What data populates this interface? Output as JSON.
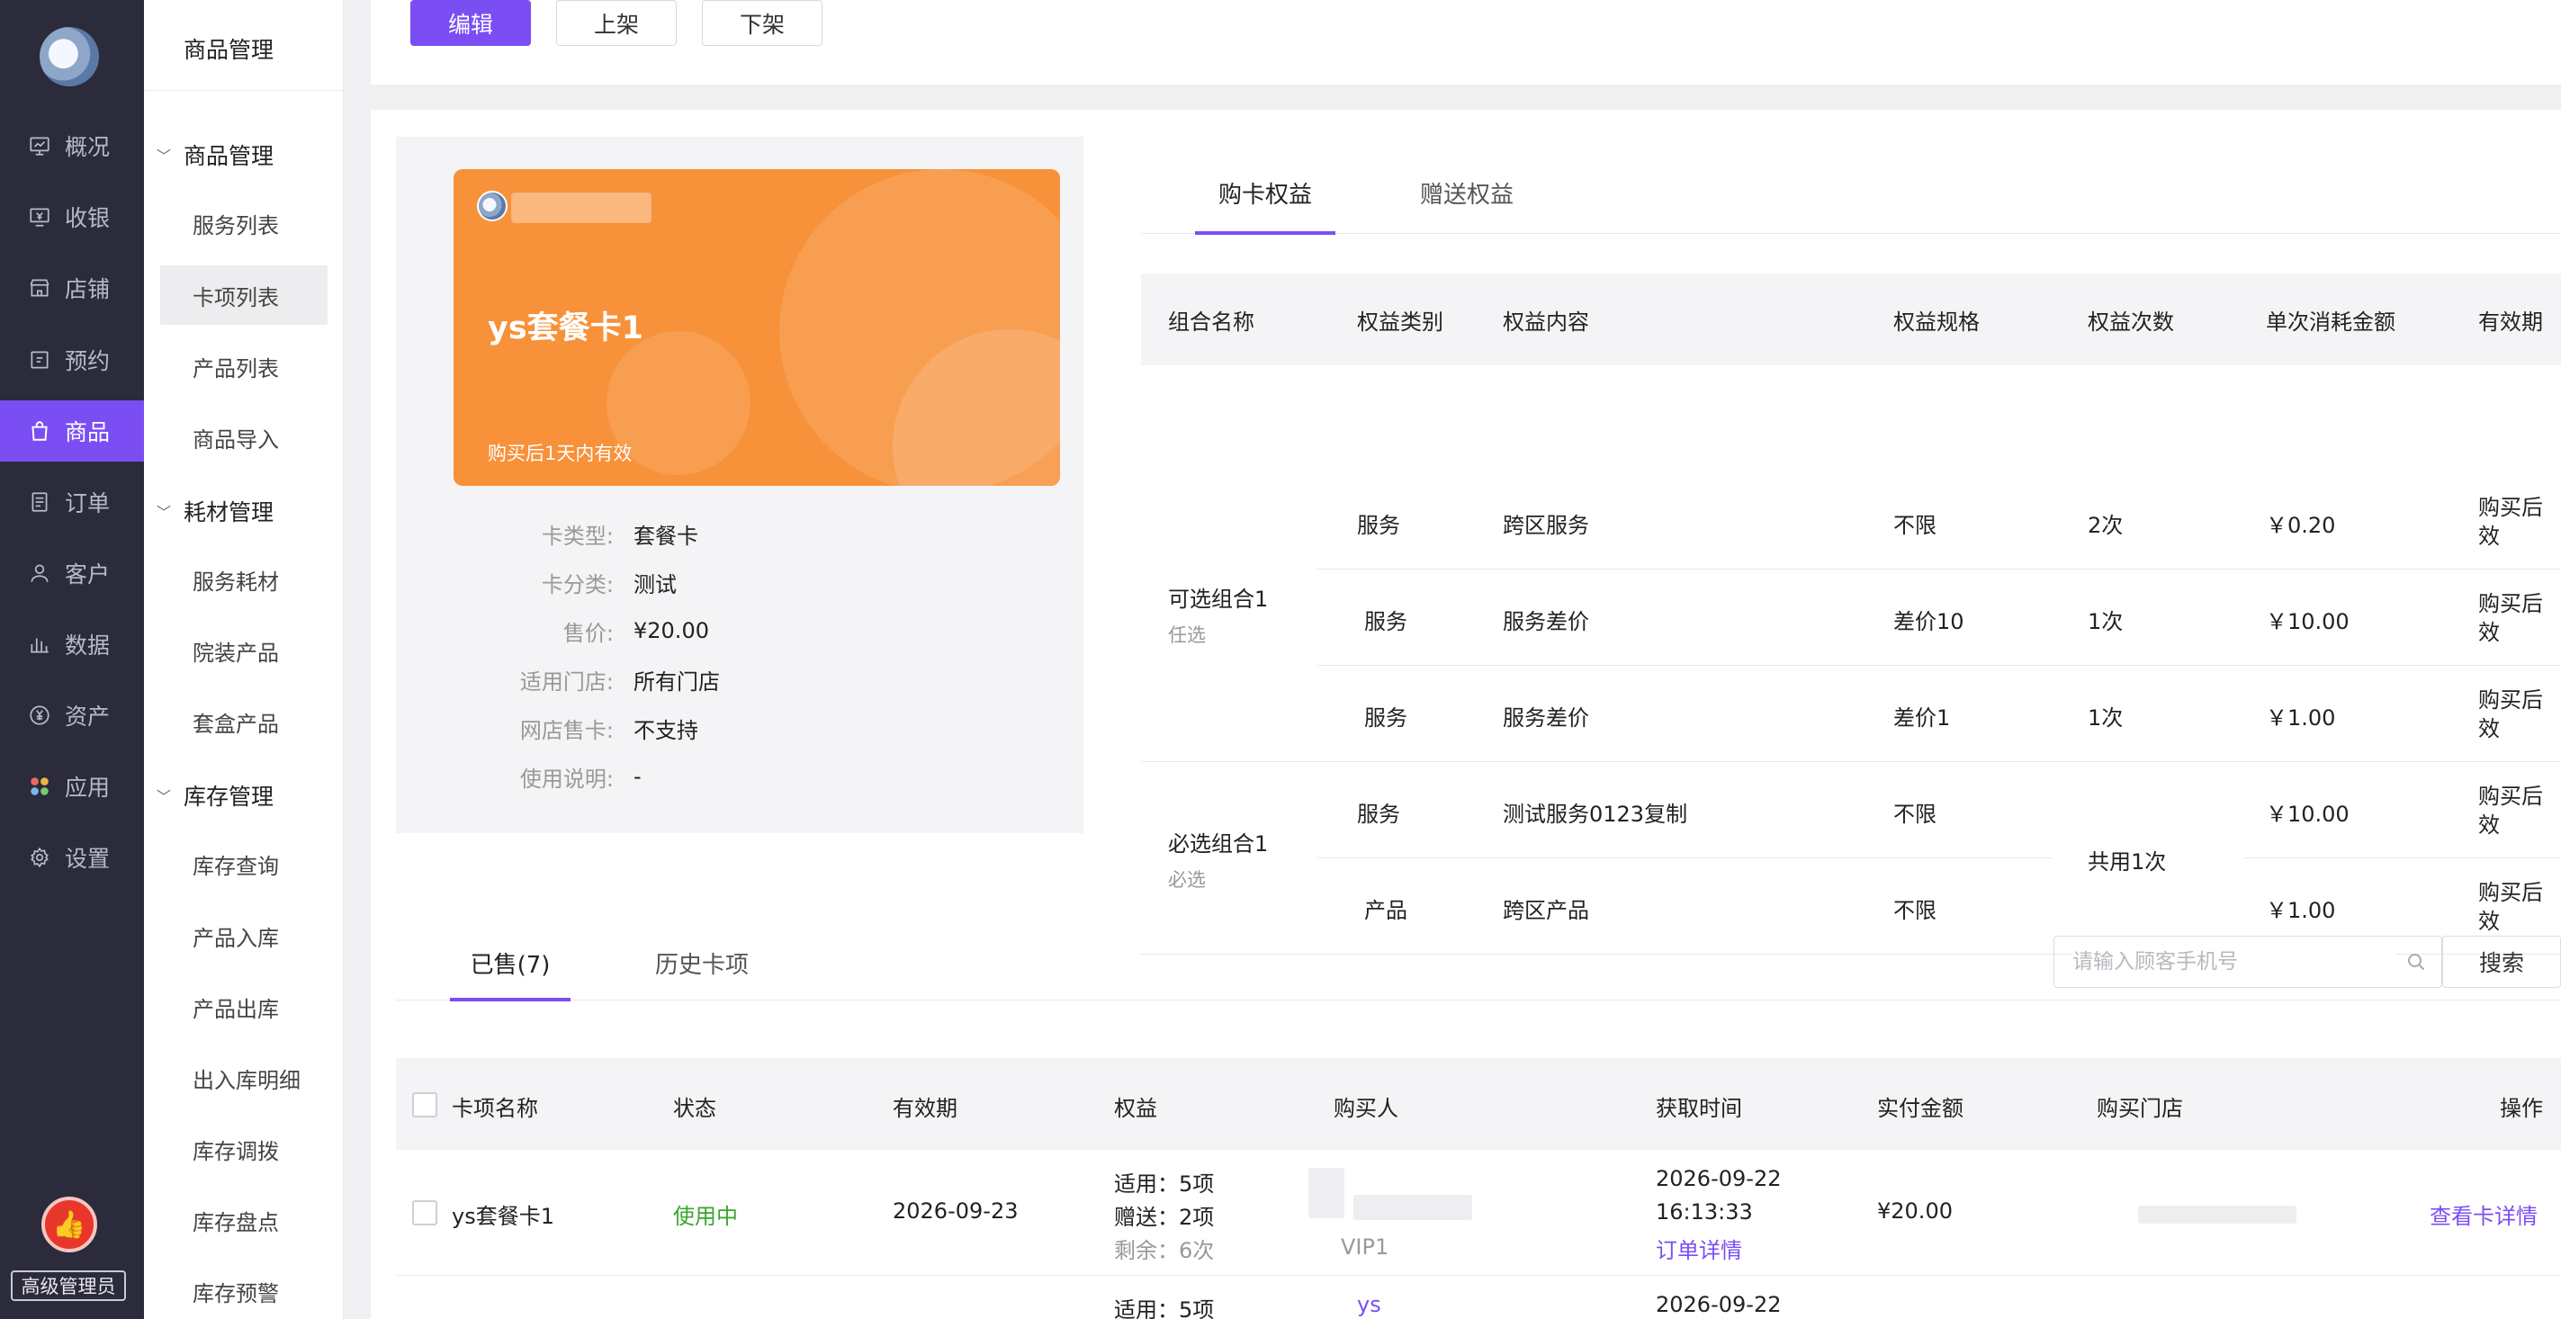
{
  "rail": {
    "items": [
      {
        "label": "概况",
        "icon": "monitor-icon"
      },
      {
        "label": "收银",
        "icon": "cashier-icon"
      },
      {
        "label": "店铺",
        "icon": "store-icon"
      },
      {
        "label": "预约",
        "icon": "calendar-icon"
      },
      {
        "label": "商品",
        "icon": "bag-icon",
        "active": true
      },
      {
        "label": "订单",
        "icon": "order-icon"
      },
      {
        "label": "客户",
        "icon": "user-icon"
      },
      {
        "label": "数据",
        "icon": "bar-chart-icon"
      },
      {
        "label": "资产",
        "icon": "yen-icon"
      },
      {
        "label": "应用",
        "icon": "apps-icon"
      },
      {
        "label": "设置",
        "icon": "gear-icon"
      }
    ],
    "role": "高级管理员",
    "accent": "#7a4ef3"
  },
  "submenu": {
    "title": "商品管理",
    "groups": [
      {
        "label": "商品管理",
        "items": [
          "服务列表",
          "卡项列表",
          "产品列表",
          "商品导入"
        ]
      },
      {
        "label": "耗材管理",
        "items": [
          "服务耗材",
          "院装产品",
          "套盒产品"
        ]
      },
      {
        "label": "库存管理",
        "items": [
          "库存查询",
          "产品入库",
          "产品出库",
          "出入库明细",
          "库存调拨",
          "库存盘点",
          "库存预警"
        ]
      }
    ],
    "active_item": "卡项列表"
  },
  "toolbar": {
    "edit": "编辑",
    "list_on": "上架",
    "list_off": "下架"
  },
  "card": {
    "name": "ys套餐卡1",
    "validity_note": "购买后1天内有效",
    "color": "#f7913a",
    "info": [
      {
        "k": "卡类型:",
        "v": "套餐卡"
      },
      {
        "k": "卡分类:",
        "v": "测试"
      },
      {
        "k": "售价:",
        "v": "¥20.00"
      },
      {
        "k": "适用门店:",
        "v": "所有门店"
      },
      {
        "k": "网店售卡:",
        "v": "不支持"
      },
      {
        "k": "使用说明:",
        "v": "-"
      }
    ]
  },
  "rights_tabs": [
    "购卡权益",
    "赠送权益"
  ],
  "rights_table": {
    "headers": [
      "组合名称",
      "权益类别",
      "权益内容",
      "权益规格",
      "权益次数",
      "单次消耗金额",
      "有效期"
    ],
    "groups": [
      {
        "name": "可选组合1",
        "sub": "任选"
      },
      {
        "name": "必选组合1",
        "sub": "必选"
      }
    ],
    "rows": [
      {
        "cat": "服务",
        "content": "跨区服务",
        "spec": "不限",
        "times": "2次",
        "amount": "￥0.20",
        "valid": "购买后\n效"
      },
      {
        "cat": "服务",
        "content": "服务差价",
        "spec": "差价10",
        "times": "1次",
        "amount": "￥10.00",
        "valid": "购买后\n效"
      },
      {
        "cat": "服务",
        "content": "服务差价",
        "spec": "差价1",
        "times": "1次",
        "amount": "￥1.00",
        "valid": "购买后\n效"
      },
      {
        "cat": "服务",
        "content": "测试服务0123复制",
        "spec": "不限",
        "times": "",
        "amount": "￥10.00",
        "valid": "购买后\n效"
      },
      {
        "cat": "产品",
        "content": "跨区产品",
        "spec": "不限",
        "times": "",
        "amount": "￥1.00",
        "valid": "购买后\n效"
      }
    ],
    "shared_times": "共用1次"
  },
  "sold_tabs": [
    "已售(7)",
    "历史卡项"
  ],
  "search": {
    "placeholder": "请输入顾客手机号",
    "button": "搜索"
  },
  "sold_table": {
    "headers": [
      "卡项名称",
      "状态",
      "有效期",
      "权益",
      "购买人",
      "获取时间",
      "实付金额",
      "购买门店",
      "操作"
    ],
    "rows": [
      {
        "name": "ys套餐卡1",
        "status": "使用中",
        "expire": "2026-09-23",
        "rights": [
          "适用：5项",
          "赠送：2项",
          "剩余：6次"
        ],
        "buyer_level": "VIP1",
        "date": "2026-09-22",
        "time": "16:13:33",
        "order_link": "订单详情",
        "paid": "¥20.00",
        "action": "查看卡详情"
      },
      {
        "rights_first": "适用：5项",
        "buyer_prefix": "ys",
        "date": "2026-09-22"
      }
    ]
  }
}
